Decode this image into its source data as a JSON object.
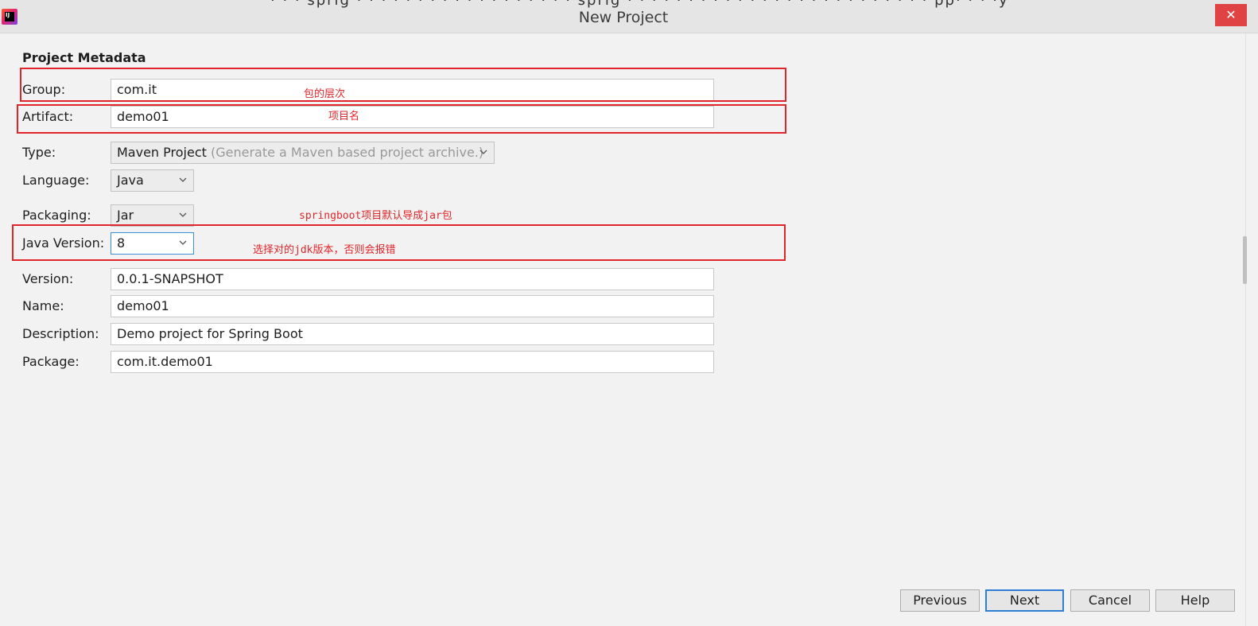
{
  "window": {
    "title": "New Project",
    "close_label": "✕",
    "top_cut_text": "· · · sprig · · · · · · · · · · · · · · · · · · sprig · · · · · · · · · · · · · · · · · · · · · · · · · pp· · · ·y"
  },
  "section": {
    "title": "Project Metadata"
  },
  "fields": {
    "group": {
      "label": "Group:",
      "value": "com.it"
    },
    "artifact": {
      "label": "Artifact:",
      "value": "demo01"
    },
    "type": {
      "label": "Type:",
      "value": "Maven Project",
      "hint": "(Generate a Maven based project archive.)"
    },
    "language": {
      "label": "Language:",
      "value": "Java"
    },
    "packaging": {
      "label": "Packaging:",
      "value": "Jar"
    },
    "java_version": {
      "label": "Java Version:",
      "value": "8"
    },
    "version": {
      "label": "Version:",
      "value": "0.0.1-SNAPSHOT"
    },
    "name": {
      "label": "Name:",
      "value": "demo01"
    },
    "description": {
      "label": "Description:",
      "value": "Demo project for Spring Boot"
    },
    "package": {
      "label": "Package:",
      "value": "com.it.demo01"
    }
  },
  "annotations": {
    "group_note": "包的层次",
    "artifact_note": "项目名",
    "packaging_note": "springboot项目默认导成jar包",
    "java_version_note": "选择对的jdk版本，否则会报错"
  },
  "buttons": {
    "previous": "Previous",
    "next": "Next",
    "cancel": "Cancel",
    "help": "Help"
  },
  "colors": {
    "annotation_red": "#e0262b",
    "focus_blue": "#2d7ed4",
    "close_red": "#e04343"
  }
}
